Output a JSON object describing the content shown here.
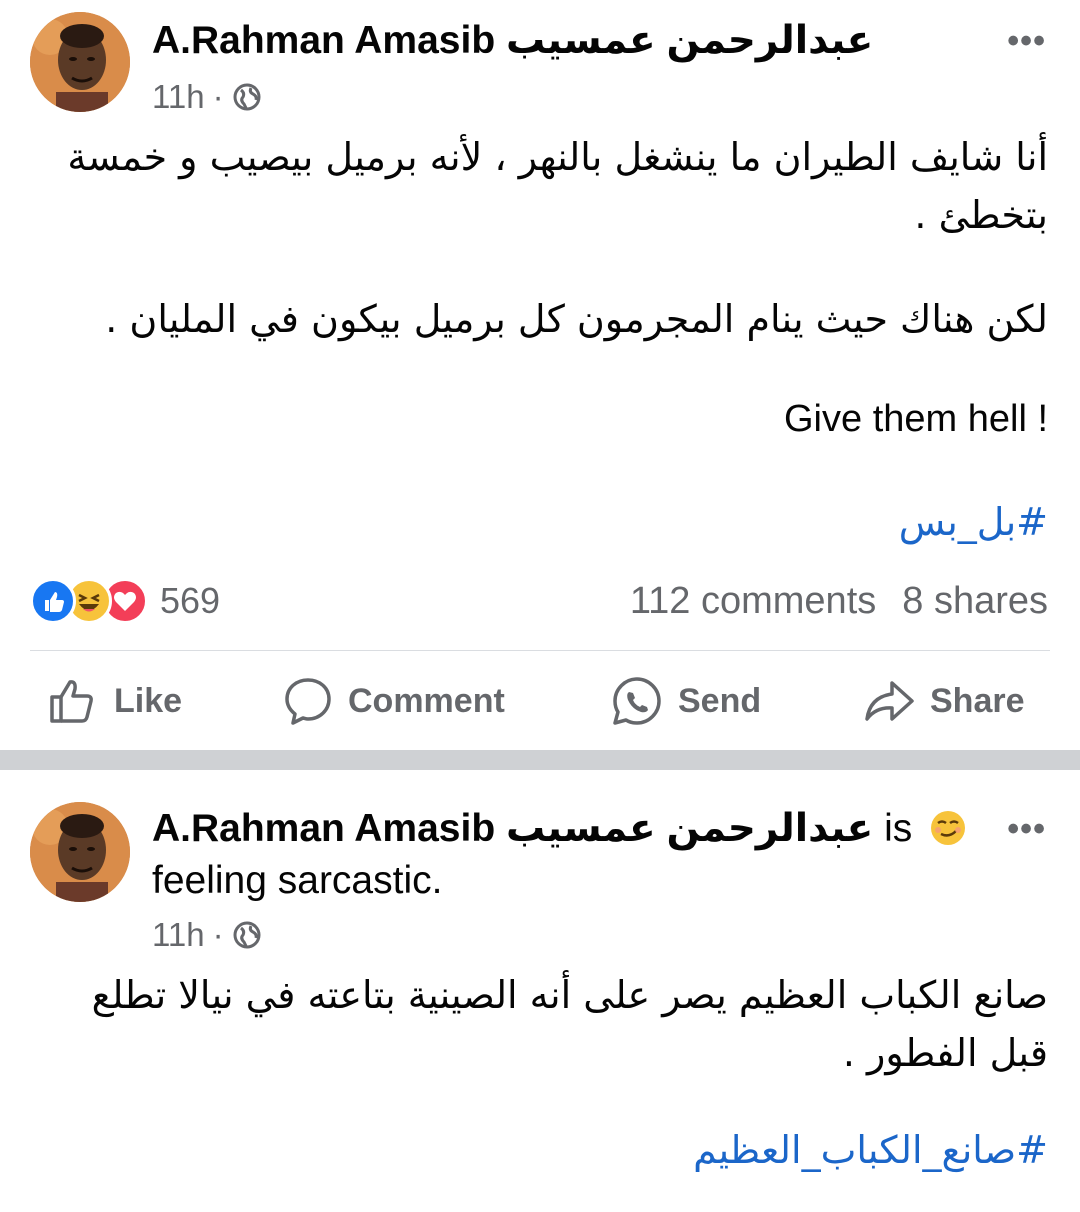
{
  "post1": {
    "author_latin": "A.Rahman Amasib",
    "author_arabic": "عبدالرحمن عمسيب",
    "time": "11h",
    "dot": "·",
    "privacy_icon": "globe-icon",
    "more_icon": "more-options-icon",
    "more_label": "•••",
    "body_paragraph_1": "أنا شايف الطيران ما ينشغل بالنهر ، لأنه برميل بيصيب و خمسة بتخطئ .",
    "body_paragraph_2": "لكن هناك حيث ينام المجرمون كل برميل بيكون في المليان .",
    "body_english": "Give them hell !",
    "hashtag": "#بل_بس",
    "reaction_icons": [
      "like-reaction-icon",
      "haha-reaction-icon",
      "love-reaction-icon"
    ],
    "reaction_count": "569",
    "comments": "112 comments",
    "shares": "8 shares",
    "actions": {
      "like": "Like",
      "comment": "Comment",
      "send": "Send",
      "share": "Share"
    }
  },
  "post2": {
    "author_latin": "A.Rahman Amasib",
    "author_arabic": "عبدالرحمن عمسيب",
    "is_word": "is",
    "feeling_emoji": "smirk-emoji-icon",
    "feeling_text": "feeling sarcastic.",
    "time": "11h",
    "dot": "·",
    "privacy_icon": "globe-icon",
    "more_label": "•••",
    "body": "صانع الكباب العظيم يصر على أنه الصينية بتاعته في نيالا تطلع قبل الفطور .",
    "hashtag": "#صانع_الكباب_العظيم"
  },
  "colors": {
    "text": "#050505",
    "secondary": "#65676b",
    "link": "#1b66c9",
    "separator": "#cfd1d4",
    "like_blue": "#1877f2",
    "love_red": "#f33e58",
    "haha_yellow": "#f7c33b"
  }
}
